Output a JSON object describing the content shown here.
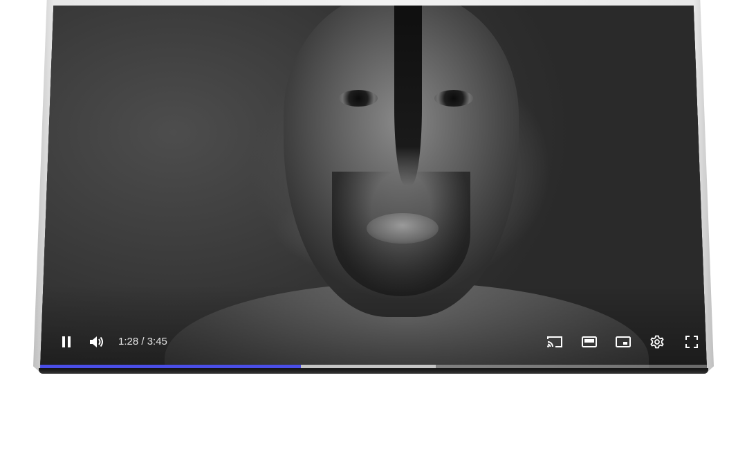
{
  "player": {
    "time_display": "1:28 / 3:45",
    "progress": {
      "played_fraction": 0.391,
      "buffered_fraction": 0.593,
      "played_color": "#4a4ee8"
    },
    "controls_left": [
      {
        "name": "pause-button",
        "icon": "pause-icon"
      },
      {
        "name": "volume-button",
        "icon": "volume-icon"
      }
    ],
    "controls_right": [
      {
        "name": "cast-button",
        "icon": "cast-icon"
      },
      {
        "name": "theater-mode-button",
        "icon": "theater-mode-icon"
      },
      {
        "name": "miniplayer-button",
        "icon": "miniplayer-icon"
      },
      {
        "name": "settings-button",
        "icon": "gear-icon"
      },
      {
        "name": "fullscreen-button",
        "icon": "fullscreen-icon"
      }
    ]
  }
}
